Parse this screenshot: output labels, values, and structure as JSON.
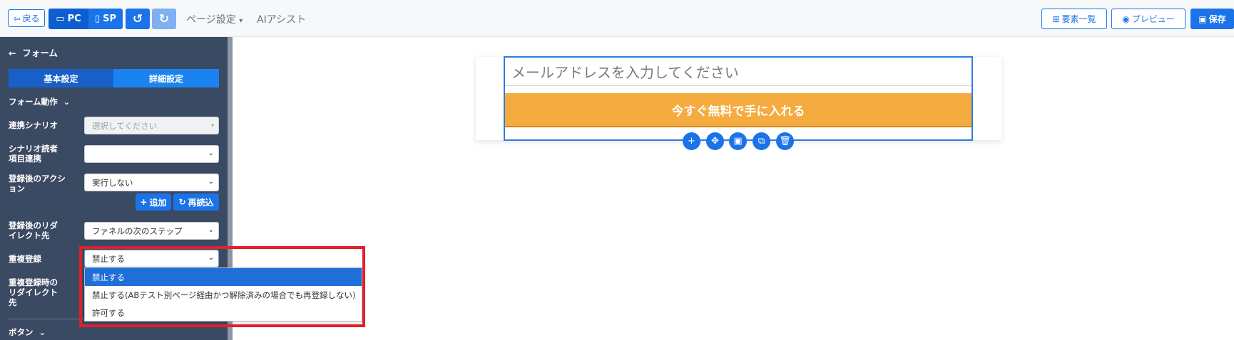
{
  "topbar": {
    "back_label": "戻る",
    "pc_label": "PC",
    "sp_label": "SP",
    "page_settings_label": "ページ設定",
    "ai_assist_label": "AIアシスト",
    "elements_list_label": "要素一覧",
    "preview_label": "プレビュー",
    "save_label": "保存"
  },
  "sidebar": {
    "title": "フォーム",
    "tabs": [
      "基本設定",
      "詳細設定"
    ],
    "section_form_action": "フォーム動作",
    "rows": {
      "scenario_label": "連携シナリオ",
      "scenario_value": "選択してください",
      "reader_field_label": "シナリオ読者\n項目連携",
      "reader_field_value": "",
      "after_action_label": "登録後のアクシ\nョン",
      "after_action_value": "実行しない",
      "add_button": "追加",
      "reload_button": "再読込",
      "redirect_label": "登録後のリダ\nイレクト先",
      "redirect_value": "ファネルの次のステップ",
      "duplicate_label": "重複登録",
      "duplicate_value": "禁止する",
      "duplicate_redirect_label": "重複登録時の\nリダイレクト\n先"
    },
    "section_button": "ボタン"
  },
  "dropdown": {
    "options": [
      "禁止する",
      "禁止する(ABテスト別ページ経由かつ解除済みの場合でも再登録しない)",
      "許可する"
    ],
    "selected_index": 0
  },
  "canvas": {
    "email_placeholder": "メールアドレスを入力してください",
    "cta_label": "今すぐ無料で手に入れる",
    "tools": [
      "plus-icon",
      "move-icon",
      "save-icon",
      "copy-icon",
      "trash-icon"
    ]
  },
  "colors": {
    "accent": "#1a73e8",
    "sidebar_bg": "#3b4a63",
    "cta": "#f5ab3f",
    "highlight": "#e0202a"
  }
}
